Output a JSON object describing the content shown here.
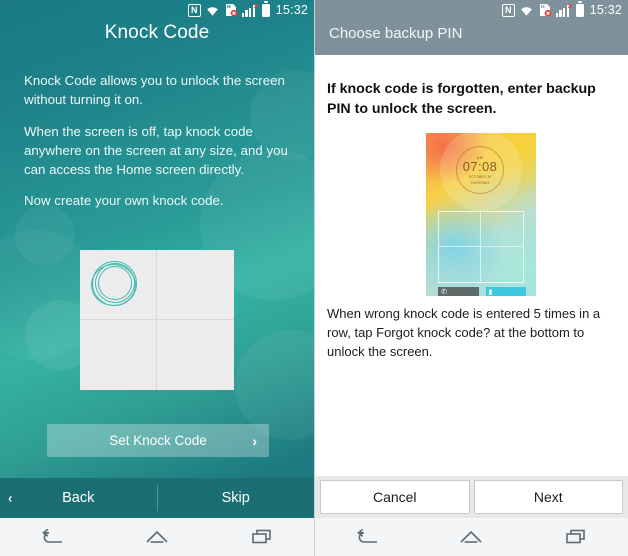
{
  "status_bar": {
    "icons": [
      "nfc-icon",
      "wifi-icon",
      "sd-card-error-icon",
      "signal-bars-icon",
      "battery-icon"
    ],
    "nfc_glyph": "N",
    "signal_error_glyph": "×",
    "time": "15:32"
  },
  "left_screen": {
    "title": "Knock Code",
    "paragraphs": [
      "Knock Code allows you to unlock the screen without turning it on.",
      "When the screen is off, tap knock code anywhere on the screen at any size, and you can access the Home screen directly.",
      "Now create your own knock code."
    ],
    "knock_grid": {
      "cells": [
        "top-left",
        "top-right",
        "bottom-left",
        "bottom-right"
      ],
      "active_cell": "top-left",
      "ripple_color": "#3fb8b2"
    },
    "set_button": {
      "label": "Set Knock Code",
      "chevron": "›"
    },
    "bottom_bar": {
      "back_chevron": "‹",
      "back_label": "Back",
      "skip_label": "Skip"
    },
    "accent_color": "#2a9c98",
    "bar_color": "#1b6e73"
  },
  "right_screen": {
    "title": "Choose backup PIN",
    "heading": "If knock code is forgotten, enter backup PIN to unlock the screen.",
    "illustration": {
      "meridiem": "AM",
      "time": "07:08",
      "date_line1": "OCTOBER 30",
      "date_line2": "THURSDAY",
      "call_glyph": "✆",
      "lock_glyph": "▮"
    },
    "note": "When wrong knock code is entered 5 times in a row, tap Forgot knock code? at the bottom to unlock the screen.",
    "buttons": {
      "cancel_label": "Cancel",
      "next_label": "Next"
    },
    "header_color": "#7f929b"
  },
  "nav_bar": {
    "items": [
      "back-nav-icon",
      "home-nav-icon",
      "recents-nav-icon"
    ]
  }
}
